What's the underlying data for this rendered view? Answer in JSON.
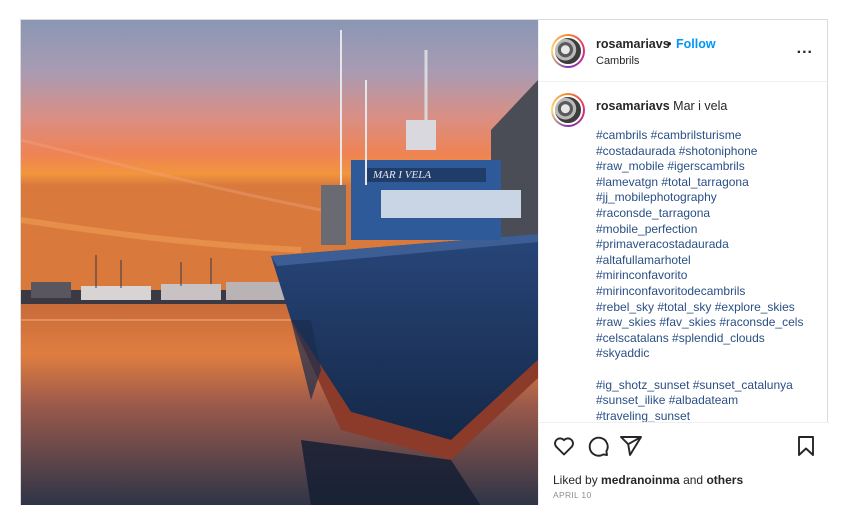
{
  "post": {
    "username": "rosamariavs",
    "separator": "•",
    "follow_label": "Follow",
    "location": "Cambrils",
    "more_label": "...",
    "caption_username": "rosamariavs",
    "caption_text": "Mar i vela",
    "boat_name": "MAR I VELA",
    "hashtag_lines": [
      "#cambrils #cambrilsturisme",
      "#costadaurada #shotoniphone",
      "#raw_mobile #igerscambrils",
      "#lamevatgn #total_tarragona",
      "#jj_mobilephotography",
      "#raconsde_tarragona",
      "#mobile_perfection",
      "#primaveracostadaurada",
      "#altafullamarhotel",
      "#mirinconfavorito",
      "#mirinconfavoritodecambrils",
      "#rebel_sky #total_sky #explore_skies",
      "#raw_skies #fav_skies #raconsde_cels",
      "#celscatalans #splendid_clouds",
      "#skyaddic",
      "",
      "#ig_shotz_sunset #sunset_catalunya",
      "#sunset_ilike #albadateam",
      "#traveling_sunset"
    ],
    "liked_by_prefix": "Liked by",
    "liked_by_user": "medranoinma",
    "liked_by_and": "and",
    "liked_by_others": "others",
    "date": "APRIL 10"
  },
  "icons": {
    "like": "heart-icon",
    "comment": "comment-icon",
    "share": "paper-plane-icon",
    "save": "bookmark-icon",
    "more": "more-icon"
  },
  "colors": {
    "follow": "#0095f6",
    "hashtag": "#2a4f85",
    "text": "#262626",
    "muted": "#8e8e8e"
  }
}
